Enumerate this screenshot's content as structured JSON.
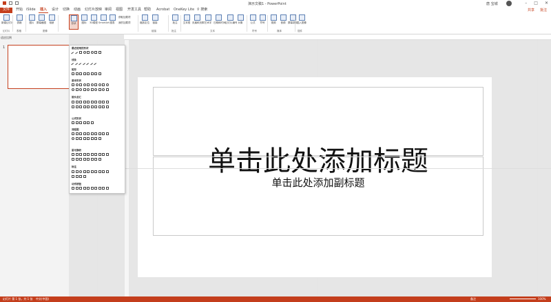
{
  "app": {
    "doc_title": "演示文稿1 - PowerPoint",
    "user": "唐 宝城",
    "search": "搜索"
  },
  "menu": {
    "tabs": [
      "文件",
      "开始",
      "iSlide",
      "插入",
      "设计",
      "切换",
      "动画",
      "幻灯片放映",
      "审阅",
      "视图",
      "开发工具",
      "帮助",
      "Acrobat",
      "OneKey Lite"
    ],
    "active": "插入",
    "share": "共享",
    "comment": "批注"
  },
  "ribbon": {
    "buttons": [
      {
        "label": "新建幻灯片"
      },
      {
        "label": "表格"
      },
      {
        "label": "图片"
      },
      {
        "label": "屏幕截图"
      },
      {
        "label": "相册"
      },
      {
        "label": "形状"
      },
      {
        "label": "图标"
      },
      {
        "label": "3D模型"
      },
      {
        "label": "SmartArt"
      },
      {
        "label": "图表"
      },
      {
        "label": "缩放定位"
      },
      {
        "label": "链接"
      },
      {
        "label": "批注"
      },
      {
        "label": "文本框"
      },
      {
        "label": "页眉和页脚"
      },
      {
        "label": "艺术字"
      },
      {
        "label": "日期和时间"
      },
      {
        "label": "幻灯片编号"
      },
      {
        "label": "对象"
      },
      {
        "label": "公式"
      },
      {
        "label": "符号"
      },
      {
        "label": "视频"
      },
      {
        "label": "音频"
      },
      {
        "label": "屏幕录制"
      },
      {
        "label": "插入图像"
      }
    ],
    "side_items": [
      "获取加载项",
      "我的加载项"
    ],
    "groups": [
      "幻灯片",
      "表格",
      "图像",
      "链接",
      "批注",
      "文本",
      "符号",
      "媒体",
      "插件"
    ]
  },
  "thumbpane": {
    "slide_number": "1",
    "zoom": "适应比例"
  },
  "shapes_panel": {
    "categories": [
      "最近使用的形状",
      "线条",
      "矩形",
      "基本形状",
      "箭头总汇",
      "公式形状",
      "流程图",
      "星与旗帜",
      "标注",
      "动作按钮"
    ]
  },
  "slide": {
    "title_placeholder": "单击此处添加标题",
    "subtitle_placeholder": "单击此处添加副标题"
  },
  "status": {
    "slide_info": "幻灯片 第 1 张，共 1 张",
    "language": "中文(中国)",
    "notes": "备注",
    "zoom": "100%"
  },
  "colors": {
    "accent": "#c43e1c",
    "ribbon_bg": "#ffffff",
    "workspace": "#e6e6e6"
  }
}
